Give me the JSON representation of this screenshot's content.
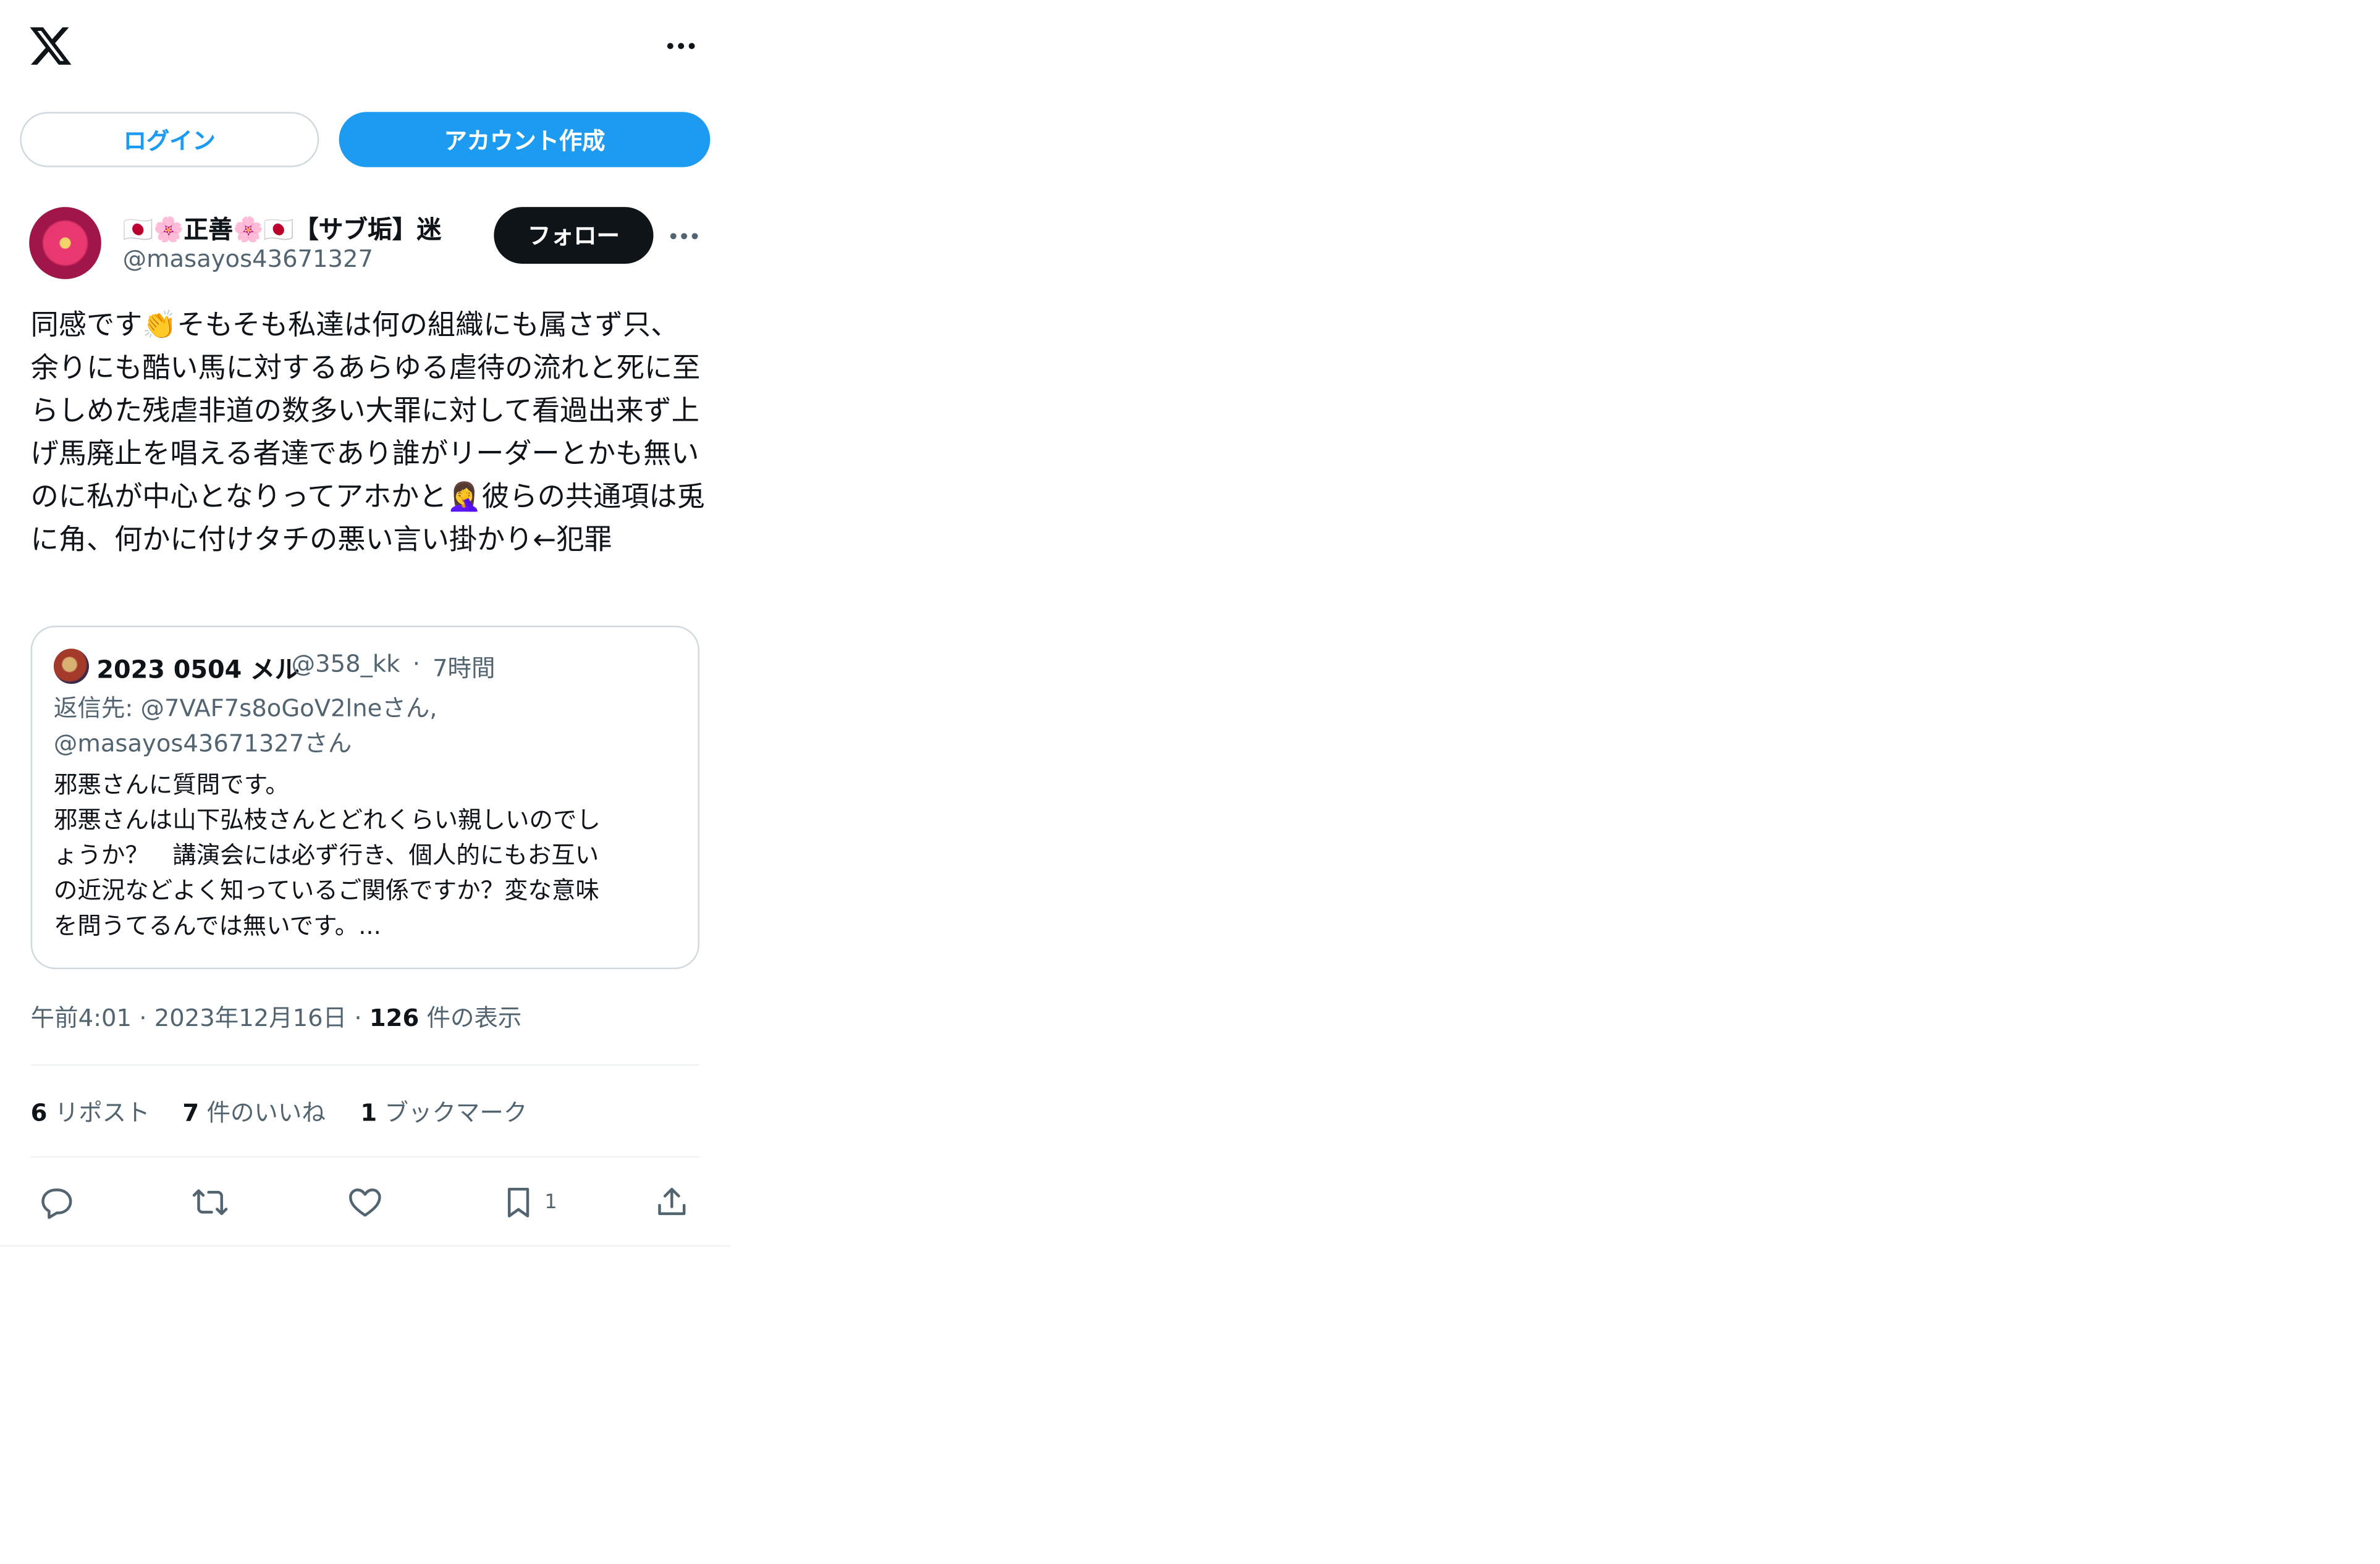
{
  "header": {
    "logo_icon": "x-logo-icon",
    "more_icon": "more-horizontal-icon"
  },
  "auth": {
    "login_label": "ログイン",
    "signup_label": "アカウント作成",
    "accent_color": "#1d9bf0"
  },
  "tweet": {
    "display_name": "🇯🇵🌸正善🌸🇯🇵【サブ垢】迷",
    "handle": "@masayos43671327",
    "follow_label": "フォロー",
    "text": "同感です👏そもそも私達は何の組織にも属さず只、余りにも酷い馬に対するあらゆる虐待の流れと死に至らしめた残虐非道の数多い大罪に対して看過出来ず上げ馬廃止を唱える者達であり誰がリーダーとかも無いのに私が中心となりってアホかと🤦‍♀️彼らの共通項は兎に角、何かに付けタチの悪い言い掛かり←犯罪",
    "time": "午前4:01",
    "date": "2023年12月16日",
    "views_count": "126",
    "views_label": "件の表示",
    "separator": "·"
  },
  "quote": {
    "display_name": "2023 0504 メル",
    "handle": "@358_kk",
    "separator": "·",
    "time": "7時間",
    "reply_to": "返信先: @7VAF7s8oGoV2lneさん,\n@masayos43671327さん",
    "text": "邪悪さんに質問です。\n邪悪さんは山下弘枝さんとどれくらい親しいのでし\nょうか？　講演会には必ず行き、個人的にもお互い\nの近況などよく知っているご関係ですか？変な意味\nを問うてるんでは無いです。..."
  },
  "stats": {
    "reposts_count": "6",
    "reposts_label": "リポスト",
    "likes_count": "7",
    "likes_label": "件のいいね",
    "bookmarks_count": "1",
    "bookmarks_label": "ブックマーク"
  },
  "actions": {
    "reply_icon": "reply-icon",
    "repost_icon": "repost-icon",
    "like_icon": "heart-icon",
    "bookmark_icon": "bookmark-icon",
    "bookmark_count": "1",
    "share_icon": "share-icon"
  }
}
